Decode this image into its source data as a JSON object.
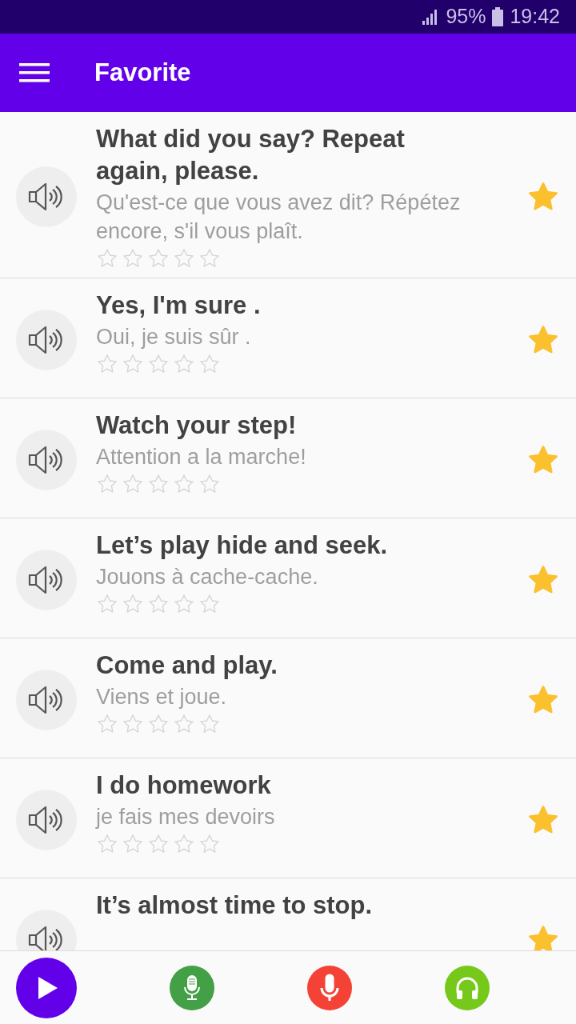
{
  "status_bar": {
    "battery": "95%",
    "time": "19:42"
  },
  "app_bar": {
    "title": "Favorite"
  },
  "phrases": [
    {
      "english": "What did you say? Repeat again, please.",
      "french": "Qu'est-ce que vous avez dit? Répétez encore, s'il vous plaît.",
      "stars": 0,
      "favorite": true
    },
    {
      "english": "Yes, I'm sure .",
      "french": "Oui, je suis sûr .",
      "stars": 0,
      "favorite": true
    },
    {
      "english": "Watch your step!",
      "french": "Attention a la marche!",
      "stars": 0,
      "favorite": true
    },
    {
      "english": "Let’s play hide and seek.",
      "french": "Jouons à cache-cache.",
      "stars": 0,
      "favorite": true
    },
    {
      "english": "Come and play.",
      "french": "Viens et joue.",
      "stars": 0,
      "favorite": true
    },
    {
      "english": "I do homework",
      "french": "je fais mes devoirs",
      "stars": 0,
      "favorite": true
    },
    {
      "english": "It’s almost time to stop.",
      "favorite": true
    }
  ]
}
